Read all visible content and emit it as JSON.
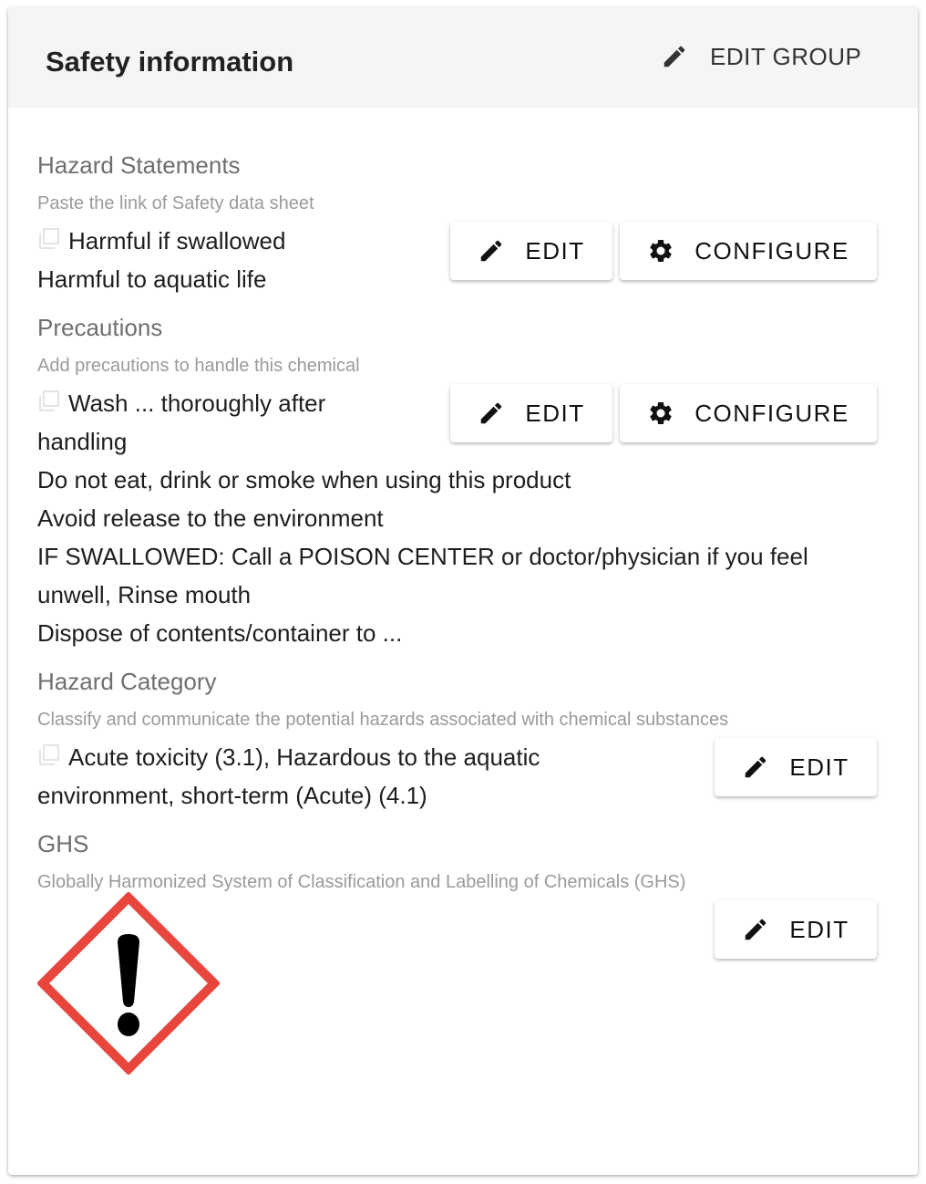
{
  "header": {
    "title": "Safety information",
    "edit_group_label": "EDIT GROUP",
    "edit_group_icon": "pencil-icon"
  },
  "sections": {
    "hazard_statements": {
      "title": "Hazard Statements",
      "description": "Paste the link of Safety data sheet",
      "lines": [
        "Harmful if swallowed",
        "Harmful to aquatic life"
      ],
      "edit_label": "EDIT",
      "configure_label": "CONFIGURE"
    },
    "precautions": {
      "title": "Precautions",
      "description": "Add precautions to handle this chemical",
      "lines": [
        "Wash ... thoroughly after",
        "handling",
        "Do not eat, drink or smoke when using this product",
        "Avoid release to the environment",
        "IF SWALLOWED: Call a POISON CENTER or doctor/physician if you feel",
        "unwell, Rinse mouth",
        "Dispose of contents/container to ..."
      ],
      "edit_label": "EDIT",
      "configure_label": "CONFIGURE"
    },
    "hazard_category": {
      "title": "Hazard Category",
      "description": "Classify and communicate the potential hazards associated with chemical substances",
      "lines": [
        "Acute toxicity (3.1), Hazardous to the aquatic",
        "environment, short-term (Acute) (4.1)"
      ],
      "edit_label": "EDIT"
    },
    "ghs": {
      "title": "GHS",
      "description": "Globally Harmonized System of Classification and Labelling of Chemicals (GHS)",
      "pictogram": "exclamation-mark-pictogram",
      "pictogram_border_color": "#e8453c",
      "edit_label": "EDIT"
    }
  }
}
